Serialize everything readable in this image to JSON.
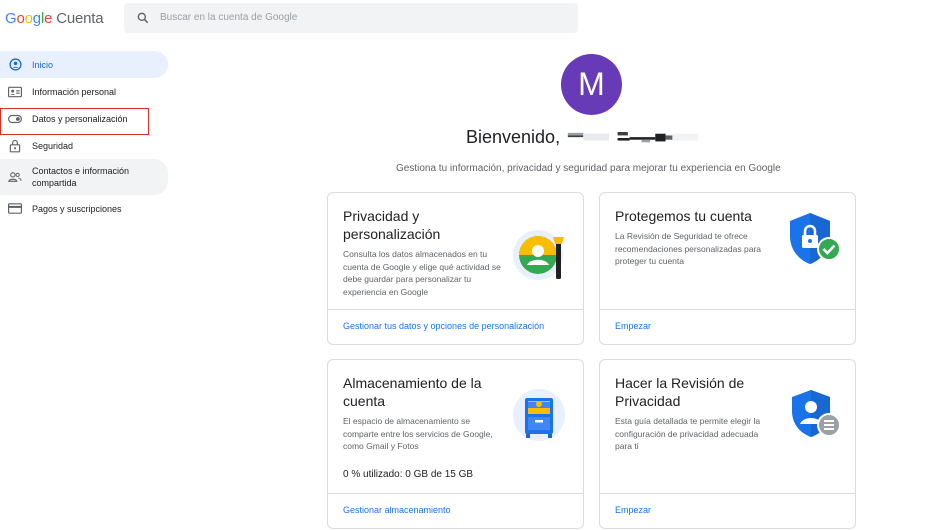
{
  "header": {
    "logo_google": "Google",
    "logo_product": "Cuenta",
    "search_placeholder": "Buscar en la cuenta de Google"
  },
  "nav": {
    "items": [
      {
        "label": "Inicio",
        "icon": "home-icon",
        "active": true
      },
      {
        "label": "Información personal",
        "icon": "id-card-icon"
      },
      {
        "label": "Datos y personalización",
        "icon": "toggle-icon"
      },
      {
        "label": "Seguridad",
        "icon": "lock-icon"
      },
      {
        "label": "Contactos e información compartida",
        "icon": "people-icon"
      },
      {
        "label": "Pagos y suscripciones",
        "icon": "credit-card-icon"
      }
    ]
  },
  "profile": {
    "avatar_letter": "M",
    "avatar_color": "#673ab7",
    "welcome": "Bienvenido,",
    "subtitle": "Gestiona tu información, privacidad y seguridad para mejorar tu experiencia en Google"
  },
  "cards": {
    "privacy": {
      "title": "Privacidad y personalización",
      "desc": "Consulta los datos almacenados en tu cuenta de Google y elige qué actividad se debe guardar para personalizar tu experiencia en Google",
      "link": "Gestionar tus datos y opciones de personalización"
    },
    "protect": {
      "title": "Protegemos tu cuenta",
      "desc": "La Revisión de Seguridad te ofrece recomendaciones personalizadas para proteger tu cuenta",
      "link": "Empezar"
    },
    "storage": {
      "title": "Almacenamiento de la cuenta",
      "desc": "El espacio de almacenamiento se comparte entre los servicios de Google, como Gmail y Fotos",
      "usage": "0 % utilizado: 0 GB de 15 GB",
      "link": "Gestionar almacenamiento"
    },
    "review": {
      "title": "Hacer la Revisión de Privacidad",
      "desc": "Esta guía detallada te permite elegir la configuración de privacidad adecuada para ti",
      "link": "Empezar"
    }
  },
  "colors": {
    "accent": "#1a73e8",
    "active_bg": "#e8f0fe",
    "highlight": "#d93025"
  }
}
